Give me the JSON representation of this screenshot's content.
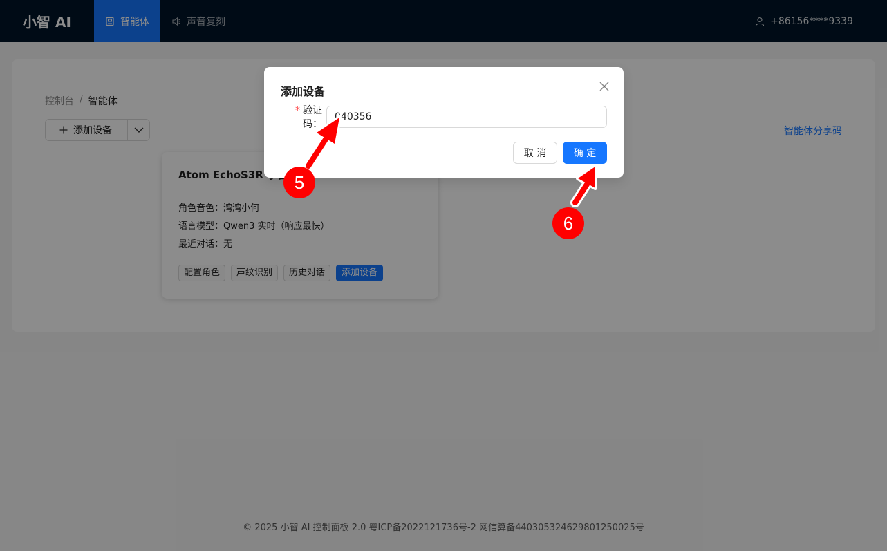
{
  "header": {
    "logo": "小智 AI",
    "nav": [
      {
        "label": "智能体",
        "icon": "robot-icon"
      },
      {
        "label": "声音复刻",
        "icon": "speaker-icon"
      }
    ],
    "user": "+86156****9339"
  },
  "breadcrumb": {
    "root": "控制台",
    "separator": "/",
    "current": "智能体"
  },
  "toolbar": {
    "add_device": "添加设备",
    "share_code": "智能体分享码"
  },
  "agent": {
    "title": "Atom EchoS3R 小智",
    "voice": "角色音色：湾湾小何",
    "model": "语言模型：Qwen3 实时（响应最快）",
    "last_chat": "最近对话：无",
    "tags": [
      "配置角色",
      "声纹识别",
      "历史对话",
      "添加设备"
    ]
  },
  "modal": {
    "title": "添加设备",
    "required_mark": "*",
    "label": "验证码：",
    "value": "040356",
    "cancel": "取 消",
    "ok": "确 定"
  },
  "annotations": {
    "step5": "5",
    "step6": "6",
    "color": "#ff0000"
  },
  "footer": "© 2025 小智 AI 控制面板 2.0 粤ICP备2022121736号-2 网信算备440305324629801250025号"
}
